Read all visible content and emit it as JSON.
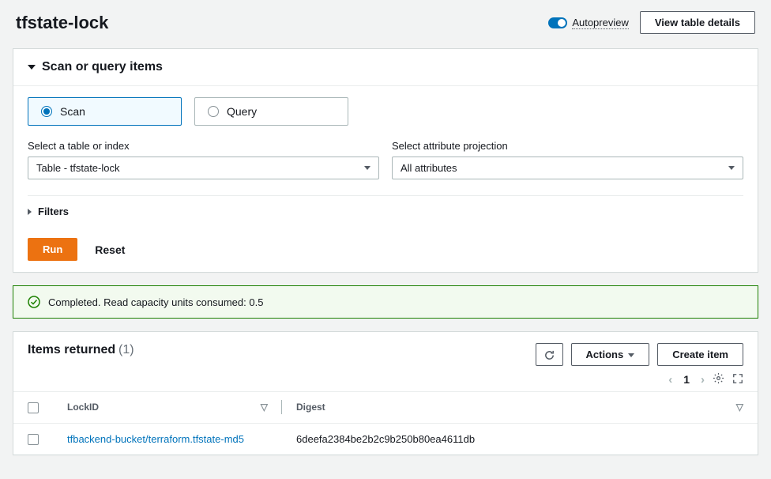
{
  "header": {
    "title": "tfstate-lock",
    "autopreview_label": "Autopreview",
    "view_details_label": "View table details"
  },
  "scan_panel": {
    "title": "Scan or query items",
    "radio_scan": "Scan",
    "radio_query": "Query",
    "table_label": "Select a table or index",
    "table_value": "Table - tfstate-lock",
    "projection_label": "Select attribute projection",
    "projection_value": "All attributes",
    "filters_label": "Filters",
    "run_label": "Run",
    "reset_label": "Reset"
  },
  "flash": {
    "message": "Completed. Read capacity units consumed: 0.5"
  },
  "items": {
    "title": "Items returned",
    "count": "(1)",
    "actions_label": "Actions",
    "create_label": "Create item",
    "page_number": "1",
    "columns": {
      "lockid": "LockID",
      "digest": "Digest"
    },
    "rows": [
      {
        "lockid": "tfbackend-bucket/terraform.tfstate-md5",
        "digest": "6deefa2384be2b2c9b250b80ea4611db"
      }
    ]
  }
}
